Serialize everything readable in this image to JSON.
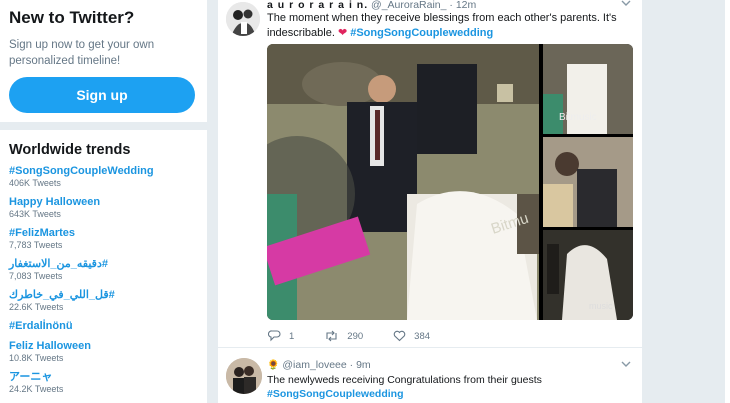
{
  "signup": {
    "title": "New to Twitter?",
    "subtitle": "Sign up now to get your own personalized timeline!",
    "button": "Sign up"
  },
  "trends": {
    "title": "Worldwide trends",
    "items": [
      {
        "name": "#SongSongCoupleWedding",
        "count": "406K Tweets"
      },
      {
        "name": "Happy Halloween",
        "count": "643K Tweets"
      },
      {
        "name": "#FelizMartes",
        "count": "7,783 Tweets"
      },
      {
        "name": "#دقيقه_من_الاستغفار",
        "count": "7,083 Tweets"
      },
      {
        "name": "#قل_اللي_في_خاطرك",
        "count": "22.6K Tweets"
      },
      {
        "name": "#Erdalİnönü",
        "count": ""
      },
      {
        "name": "Feliz Halloween",
        "count": "10.8K Tweets"
      },
      {
        "name": "アーニャ",
        "count": "24.2K Tweets"
      }
    ]
  },
  "tweet1": {
    "name": "a u r o r a r a i n.",
    "handle": "@_AuroraRain_",
    "time": "· 12m",
    "text": "The moment when they receive blessings from each other's parents. It's indescribable.",
    "hashtag": "#SongSongCouplewedding",
    "replies": "1",
    "retweets": "290",
    "likes": "384"
  },
  "tweet2": {
    "handle": "@iam_loveee",
    "time": "· 9m",
    "text": "The newlyweds receiving Congratulations from their guests",
    "hashtag": "#SongSongCouplewedding"
  },
  "colors": {
    "accent": "#1da1f2",
    "link": "#1b95e0",
    "background": "#e6ecf0"
  },
  "icons": [
    "heart-emoji",
    "sunflower-emoji",
    "reply-icon",
    "retweet-icon",
    "like-icon",
    "chevron-down-icon"
  ]
}
